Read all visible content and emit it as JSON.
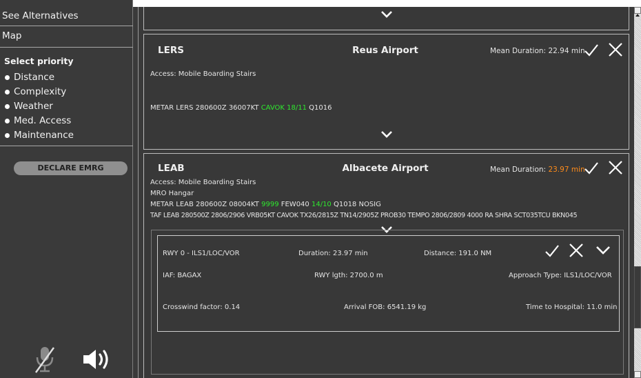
{
  "sidebar": {
    "see_alternatives": "See Alternatives",
    "map": "Map",
    "priority_title": "Select priority",
    "priorities": [
      "Distance",
      "Complexity",
      "Weather",
      "Med. Access",
      "Maintenance"
    ],
    "declare_emrg": "DECLARE EMRG",
    "icons": {
      "mic": "microphone-muted-icon",
      "speaker": "speaker-icon"
    }
  },
  "colors": {
    "panel_bg": "#3a3a3a",
    "green": "#2ee82e",
    "orange": "#ff8c1a",
    "button_grey": "#8f8f8f"
  },
  "cards": {
    "lers": {
      "icao": "LERS",
      "name": "Reus Airport",
      "duration_label": "Mean Duration: ",
      "duration_value": "22.94 min",
      "access": "Access: Mobile Boarding Stairs",
      "metar_pre": "METAR LERS 280600Z 36007KT ",
      "metar_green": "CAVOK 18/11",
      "metar_post": " Q1016"
    },
    "leab": {
      "icao": "LEAB",
      "name": "Albacete Airport",
      "duration_label": "Mean Duration: ",
      "duration_value": "23.97 min",
      "access": "Access: Mobile Boarding Stairs",
      "maintenance": "MRO Hangar",
      "metar_1": "METAR LEAB 280600Z 08004KT ",
      "metar_2": "9999",
      "metar_3": " FEW040 ",
      "metar_4": "14/10",
      "metar_5": " Q1018 NOSIG",
      "taf": "TAF LEAB 280500Z 2806/2906 VRB05KT CAVOK TX26/2815Z TN14/2905Z   PROB30   TEMPO 2806/2809 4000 RA SHRA SCT035TCU BKN045",
      "runway": {
        "rwy": "RWY 0 - ILS1/LOC/VOR",
        "duration": "Duration: 23.97 min",
        "distance": "Distance: 191.0 NM",
        "iaf": "IAF: BAGAX",
        "rwy_length": "RWY lgth: 2700.0 m",
        "approach_type": "Approach Type: ILS1/LOC/VOR",
        "crosswind": "Crosswind factor: 0.14",
        "arrival_fob": "Arrival FOB: 6541.19 kg",
        "time_to_hospital": "Time to Hospital: 11.0 min"
      }
    }
  }
}
